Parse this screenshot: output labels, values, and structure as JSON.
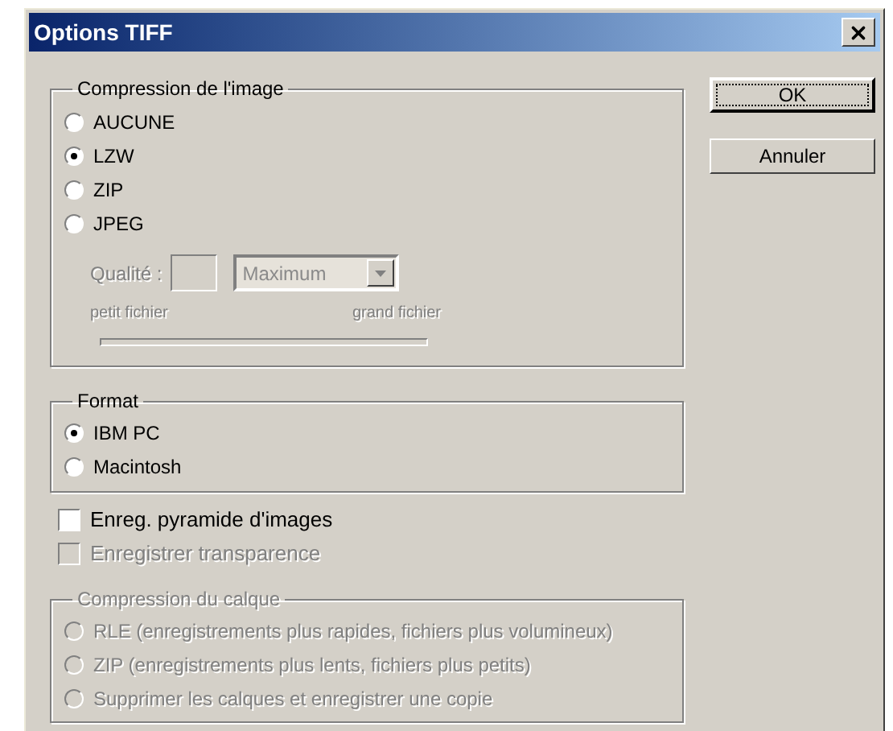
{
  "window": {
    "title": "Options TIFF"
  },
  "image_compression": {
    "label": "Compression de l'image",
    "options": [
      {
        "label": "AUCUNE",
        "selected": false
      },
      {
        "label": "LZW",
        "selected": true
      },
      {
        "label": "ZIP",
        "selected": false
      },
      {
        "label": "JPEG",
        "selected": false
      }
    ],
    "quality": {
      "label": "Qualité :",
      "dropdown_value": "Maximum",
      "disabled": true,
      "min_label": "petit fichier",
      "max_label": "grand fichier"
    }
  },
  "buttons": [
    {
      "label": "OK",
      "default": true
    },
    {
      "label": "Annuler",
      "default": false
    }
  ],
  "format": {
    "label": "Format",
    "options": [
      {
        "label": "IBM PC",
        "selected": true
      },
      {
        "label": "Macintosh",
        "selected": false
      }
    ]
  },
  "checkboxes": [
    {
      "label": "Enreg. pyramide d'images",
      "checked": false,
      "disabled": false
    },
    {
      "label": "Enregistrer transparence",
      "checked": false,
      "disabled": true
    }
  ],
  "layer_compression": {
    "label": "Compression du calque",
    "disabled": true,
    "options": [
      {
        "label": "RLE (enregistrements plus rapides, fichiers plus volumineux)",
        "selected": false
      },
      {
        "label": "ZIP (enregistrements plus lents, fichiers plus petits)",
        "selected": false
      },
      {
        "label": "Supprimer les calques et enregistrer une copie",
        "selected": false
      }
    ]
  }
}
